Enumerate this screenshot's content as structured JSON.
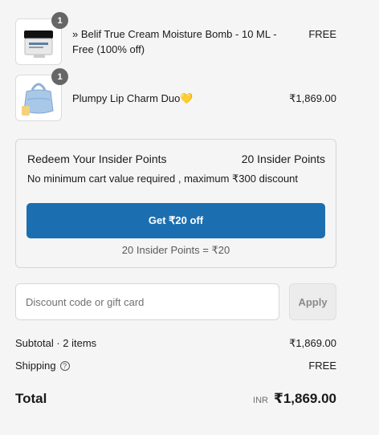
{
  "items": [
    {
      "name": "» Belif True Cream Moisture Bomb - 10 ML - Free (100% off)",
      "price": "FREE",
      "quantity": "1",
      "thumbnail_icon": "moisture-cream-jar-icon"
    },
    {
      "name": "Plumpy Lip Charm Duo💛",
      "price": "₹1,869.00",
      "quantity": "1",
      "thumbnail_icon": "lip-charm-bag-icon"
    }
  ],
  "insider_points": {
    "title": "Redeem Your Insider Points",
    "points": "20 Insider Points",
    "subtitle": "No minimum cart value required , maximum ₹300 discount",
    "button_label": "Get ₹20 off",
    "conversion": "20 Insider Points = ₹20"
  },
  "discount": {
    "placeholder": "Discount code or gift card",
    "value": "",
    "apply_label": "Apply"
  },
  "summary": {
    "subtotal_label": "Subtotal · 2 items",
    "subtotal_value": "₹1,869.00",
    "shipping_label": "Shipping",
    "shipping_value": "FREE",
    "total_label": "Total",
    "currency_code": "INR",
    "total_value": "₹1,869.00"
  },
  "colors": {
    "accent": "#1b6fb0",
    "background": "#f5f5f5",
    "badge": "#666666"
  }
}
